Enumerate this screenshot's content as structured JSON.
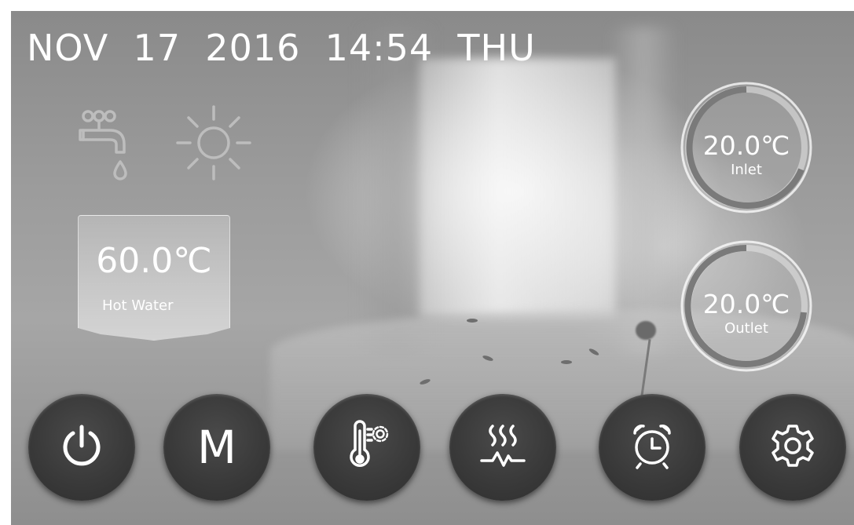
{
  "status_bar": {
    "datetime": "NOV  17  2016  14:54  THU"
  },
  "mode_icons": [
    "tap-icon",
    "sun-icon"
  ],
  "hot_water": {
    "temperature": "60.0℃",
    "label": "Hot Water"
  },
  "inlet": {
    "temperature": "20.0℃",
    "label": "Inlet"
  },
  "outlet": {
    "temperature": "20.0℃",
    "label": "Outlet"
  },
  "buttons": {
    "power": "power-icon",
    "mode_label": "M",
    "temp_settings": "thermometer-gear-icon",
    "heating": "heating-icon",
    "timer": "alarm-clock-icon",
    "settings": "gear-icon"
  },
  "colors": {
    "text": "#ffffff",
    "button": "#3a3a3a",
    "gauge_arc": "#7a7a7a"
  }
}
